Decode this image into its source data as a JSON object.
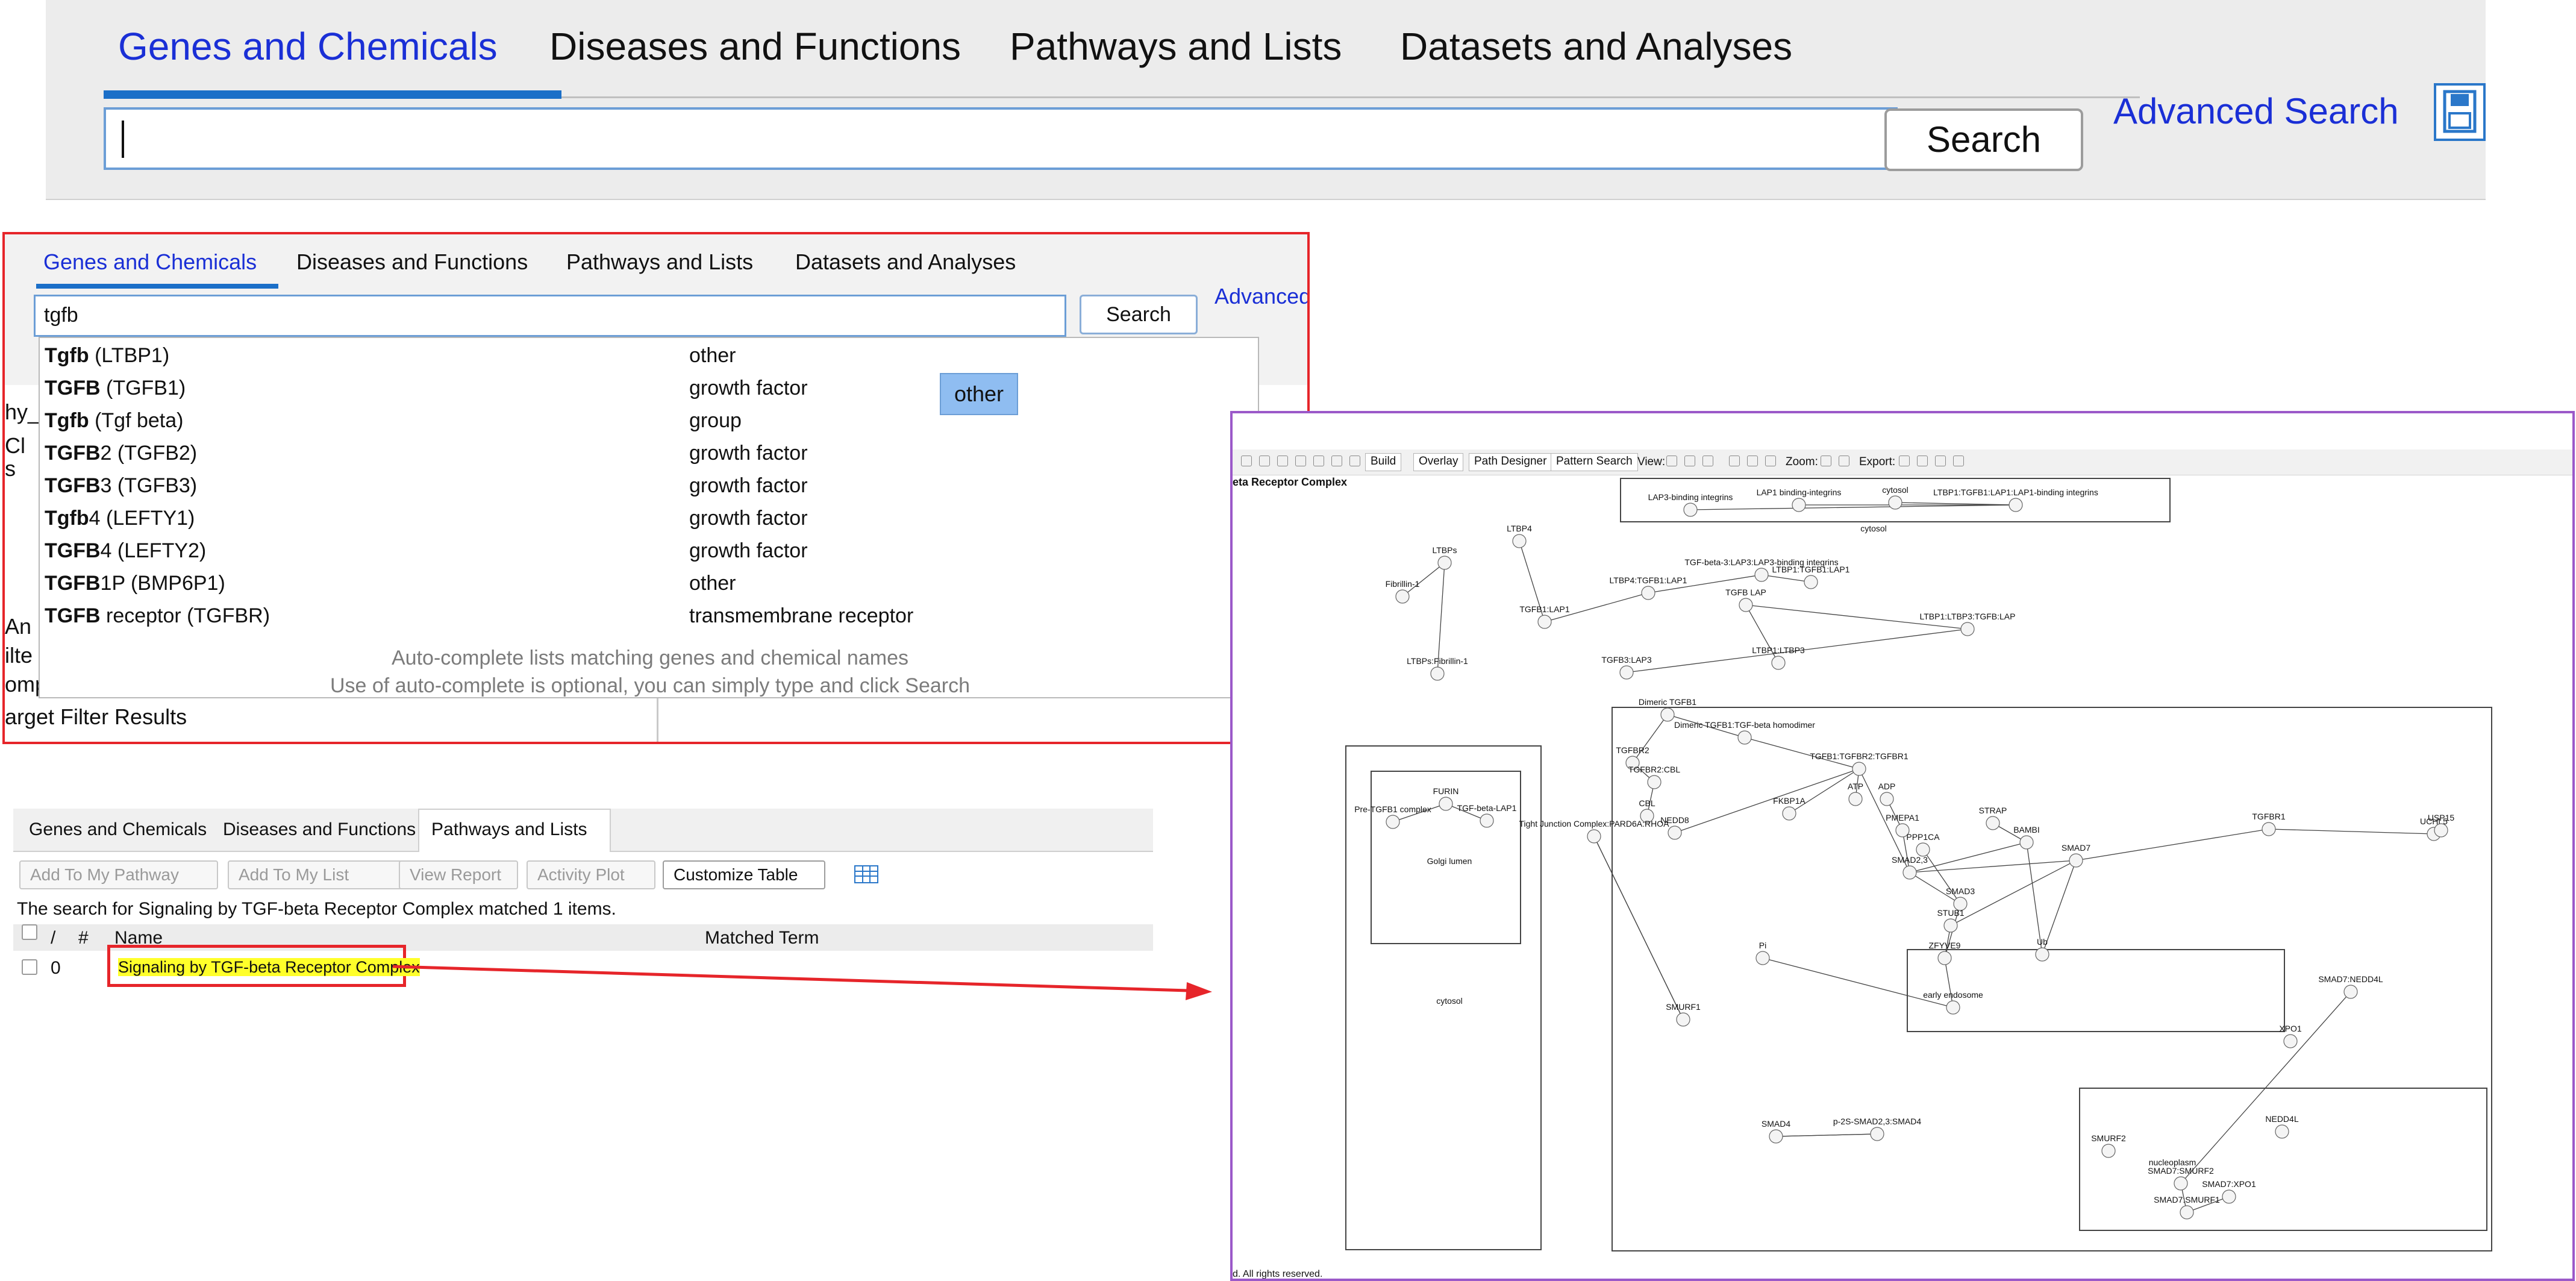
{
  "panel_main": {
    "tabs": [
      "Genes and Chemicals",
      "Diseases and Functions",
      "Pathways and Lists",
      "Datasets and Analyses"
    ],
    "search_input_value": "",
    "search_button": "Search",
    "advanced_search": "Advanced Search"
  },
  "panel_autocomplete": {
    "tabs": [
      "Genes and Chemicals",
      "Diseases and Functions",
      "Pathways and Lists",
      "Datasets and Analyses"
    ],
    "search_input_value": "tgfb",
    "search_button": "Search",
    "advanced_link": "Advanced",
    "background_fragments": [
      "hy_",
      "Cl",
      "s",
      "An",
      "ilte",
      "omparison Analyses",
      "arget Filter Results"
    ],
    "suggestions": [
      {
        "match": "Tgfb",
        "rest": " (LTBP1)",
        "type": "other"
      },
      {
        "match": "TGFB",
        "rest": " (TGFB1)",
        "type": "growth factor"
      },
      {
        "match": "Tgfb",
        "rest": " (Tgf beta)",
        "type": "group"
      },
      {
        "match": "TGFB",
        "rest": "2 (TGFB2)",
        "type": "growth factor"
      },
      {
        "match": "TGFB",
        "rest": "3 (TGFB3)",
        "type": "growth factor"
      },
      {
        "match": "Tgfb",
        "rest": "4 (LEFTY1)",
        "type": "growth factor"
      },
      {
        "match": "TGFB",
        "rest": "4 (LEFTY2)",
        "type": "growth factor"
      },
      {
        "match": "TGFB",
        "rest": "1P (BMP6P1)",
        "type": "other"
      },
      {
        "match": "TGFB",
        "rest": " receptor (TGFBR)",
        "type": "transmembrane receptor"
      }
    ],
    "hint_line1": "Auto-complete lists matching genes and chemical names",
    "hint_line2": "Use of auto-complete is optional, you can simply type and click Search",
    "tooltip": "other"
  },
  "panel_results": {
    "tabs": [
      "Genes and Chemicals",
      "Diseases and Functions",
      "Pathways and Lists"
    ],
    "toolbar": [
      "Add To My Pathway",
      "Add To My List",
      "View Report",
      "Activity Plot",
      "Customize Table"
    ],
    "message": "The search for Signaling by TGF-beta Receptor Complex matched 1 items.",
    "columns": [
      "/",
      "#",
      "Name",
      "Matched Term"
    ],
    "row": {
      "index": "0",
      "name_parts": [
        "Signaling",
        " by ",
        "TGF-beta",
        " ",
        "Receptor",
        " ",
        "Complex"
      ]
    }
  },
  "panel_pathway": {
    "title": "eta Receptor Complex",
    "footer": "d. All rights reserved.",
    "toolbar_buttons": [
      "Build",
      "Overlay",
      "Path Designer",
      "Pattern Search"
    ],
    "toolbar_labels": [
      "View:",
      "Zoom:",
      "Export:"
    ],
    "compartments": [
      "cytosol",
      "Golgi lumen",
      "cytosol",
      "nucleoplasm"
    ],
    "nodes": [
      "LAP3-binding integrins",
      "LAP1 binding-integrins",
      "cytosol",
      "LTBP1:TGFB1:LAP1:LAP1-binding integrins",
      "LTBP4",
      "LTBPs",
      "Fibrillin-1",
      "LTBP4:TGFB1:LAP1",
      "TGFB1:LAP1",
      "TGF-beta-3:LAP3:LAP3-binding integrins",
      "LTBP1:TGFB1:LAP1",
      "TGFB LAP",
      "LTBPs:Fibrillin-1",
      "LTBP1:LTBP3:TGFB:LAP",
      "TGFB3:LAP3",
      "LTBP1:LTBP3",
      "Dimeric TGFB1",
      "Dimeric TGFB1:TGF-beta homodimer",
      "TGFBR2",
      "TGFBR2:CBL",
      "CBL",
      "NEDD8",
      "TGFB1:TGFBR2:TGFBR1",
      "FKBP1A",
      "ATP",
      "ADP",
      "PMEPA1",
      "SMAD2,3",
      "SMAD3",
      "SMAD7",
      "STUB1",
      "ZFYVE9",
      "Pre-TGFB1 complex",
      "FURIN",
      "TGF-beta-LAP1",
      "Tight Junction Complex:PARD6A:RHOA",
      "SMURF1",
      "SMURF2",
      "SMAD4",
      "XPO1",
      "NEDD4L",
      "UCHL5",
      "USP15",
      "TGFBR1",
      "Ub",
      "BAMBI",
      "STRAP",
      "PPP1CA",
      "Pi",
      "SMAD7:SMURF2",
      "SMAD7:SMURF1",
      "SMAD7:XPO1",
      "SMAD7:NEDD4L",
      "p-2S-SMAD2,3:SMAD4",
      "early endosome"
    ],
    "colors": {
      "frame": "#9b59c9",
      "node_fill": "#f4f4f4",
      "edge": "#444444"
    }
  },
  "colors": {
    "accent_blue": "#1a2fd6",
    "tab_underline": "#1b6fc8",
    "highlight_red": "#e6252a",
    "highlight_yellow": "#ffff2a"
  }
}
